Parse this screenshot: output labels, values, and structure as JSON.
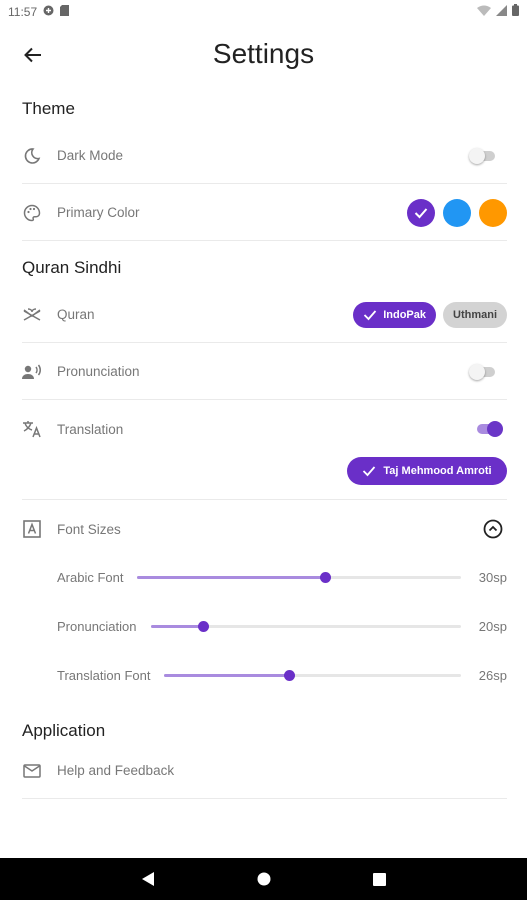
{
  "status_bar": {
    "time": "11:57"
  },
  "app_bar": {
    "title": "Settings"
  },
  "sections": {
    "theme": "Theme",
    "quran": "Quran Sindhi",
    "application": "Application"
  },
  "theme": {
    "dark_mode": {
      "label": "Dark Mode",
      "enabled": false
    },
    "primary_color": {
      "label": "Primary Color",
      "options": [
        "#6a2fc8",
        "#2196f3",
        "#ff9800"
      ],
      "selected": "#6a2fc8"
    }
  },
  "quran": {
    "script": {
      "label": "Quran",
      "options": [
        "IndoPak",
        "Uthmani"
      ],
      "selected": "IndoPak"
    },
    "pronunciation": {
      "label": "Pronunciation",
      "enabled": false
    },
    "translation": {
      "label": "Translation",
      "enabled": true,
      "translator": "Taj Mehmood Amroti"
    },
    "font_sizes": {
      "label": "Font Sizes",
      "sliders": [
        {
          "label": "Arabic Font",
          "value_label": "30sp",
          "fraction": 0.58
        },
        {
          "label": "Pronunciation",
          "value_label": "20sp",
          "fraction": 0.17
        },
        {
          "label": "Translation Font",
          "value_label": "26sp",
          "fraction": 0.42
        }
      ]
    }
  },
  "application": {
    "help": {
      "label": "Help and Feedback"
    }
  },
  "colors": {
    "accent": "#6a2fc8",
    "accent_light": "#a98bdf"
  }
}
